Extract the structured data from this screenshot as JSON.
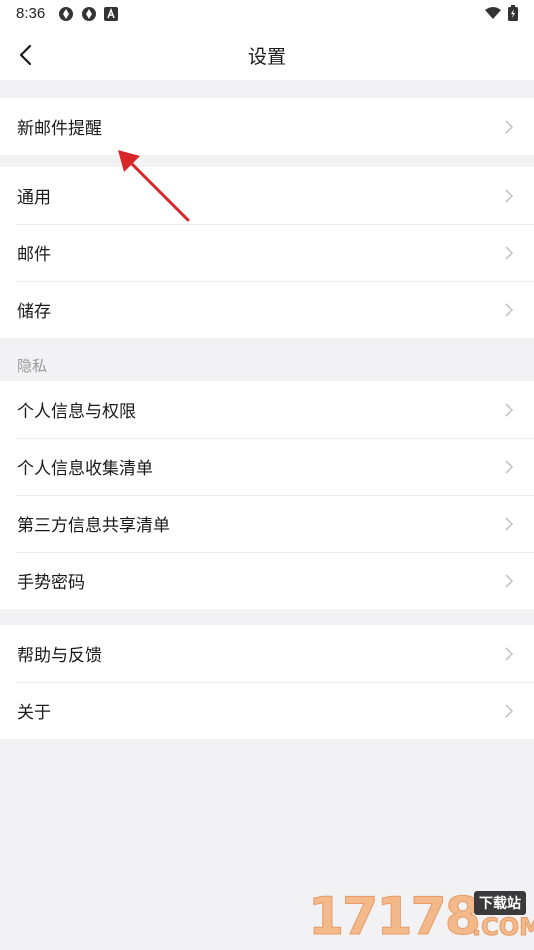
{
  "status_bar": {
    "time": "8:36",
    "left_icons": [
      "aperture-icon",
      "aperture-icon",
      "app-a-icon"
    ],
    "right_icons": [
      "wifi-icon",
      "battery-charging-icon"
    ]
  },
  "header": {
    "title": "设置",
    "back_icon": "chevron-left-icon"
  },
  "groups": [
    {
      "items": [
        {
          "label": "新邮件提醒"
        }
      ]
    },
    {
      "items": [
        {
          "label": "通用"
        },
        {
          "label": "邮件"
        },
        {
          "label": "储存"
        }
      ]
    },
    {
      "section_title": "隐私",
      "items": [
        {
          "label": "个人信息与权限"
        },
        {
          "label": "个人信息收集清单"
        },
        {
          "label": "第三方信息共享清单"
        },
        {
          "label": "手势密码"
        }
      ]
    },
    {
      "items": [
        {
          "label": "帮助与反馈"
        },
        {
          "label": "关于"
        }
      ]
    }
  ],
  "annotation": {
    "color": "#d9262b"
  },
  "watermark": {
    "digits": "17178",
    "badge": "下载站",
    "suffix": ".COM"
  },
  "colors": {
    "background": "#f2f2f4",
    "surface": "#ffffff",
    "text": "#1a1a1a",
    "secondary_text": "#9a9a9a",
    "chevron": "#c4c4c4"
  }
}
